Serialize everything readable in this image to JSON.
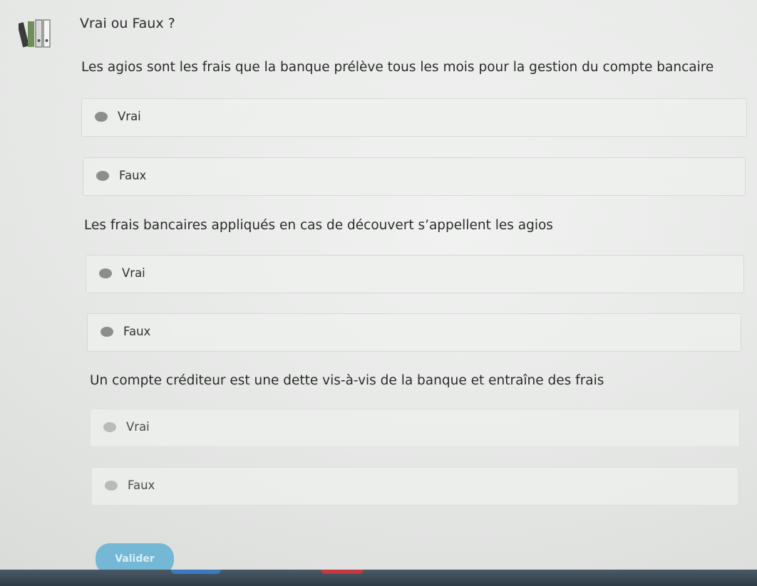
{
  "header": {
    "title": "Vrai ou Faux ?",
    "logo_icon": "binders-icon"
  },
  "questions": [
    {
      "text": "Les agios sont les frais que la banque prélève tous les mois pour la gestion du compte bancaire",
      "options": [
        {
          "label": "Vrai"
        },
        {
          "label": "Faux"
        }
      ]
    },
    {
      "text": "Les frais bancaires appliqués en cas de découvert s’appellent les agios",
      "options": [
        {
          "label": "Vrai"
        },
        {
          "label": "Faux"
        }
      ]
    },
    {
      "text": "Un compte créditeur est une dette vis-à-vis de la banque et entraîne des frais",
      "options": [
        {
          "label": "Vrai"
        },
        {
          "label": "Faux"
        }
      ]
    }
  ],
  "actions": {
    "validate_label": "Valider"
  },
  "colors": {
    "button": "#74b8d6",
    "radio": "#8b8f8c",
    "background": "#eceeec"
  }
}
